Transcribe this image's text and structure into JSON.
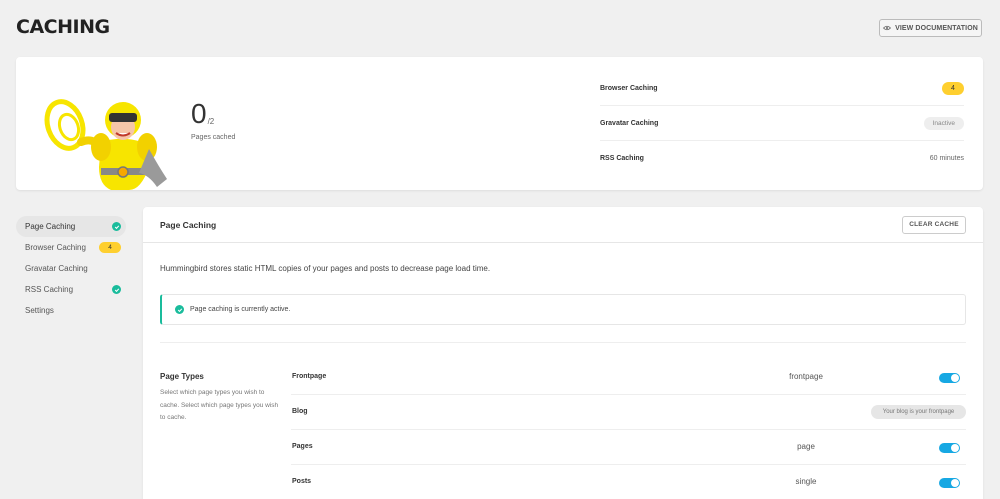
{
  "header": {
    "title": "CACHING",
    "doc_button": "VIEW DOCUMENTATION"
  },
  "summary": {
    "pages_cached": "0",
    "pages_total": "/2",
    "pages_cached_label": "Pages cached",
    "rows": [
      {
        "label": "Browser Caching",
        "value": "4"
      },
      {
        "label": "Gravatar Caching",
        "value": "Inactive"
      },
      {
        "label": "RSS Caching",
        "value": "60 minutes"
      }
    ]
  },
  "sidebar": {
    "items": [
      {
        "label": "Page Caching"
      },
      {
        "label": "Browser Caching",
        "badge": "4"
      },
      {
        "label": "Gravatar Caching"
      },
      {
        "label": "RSS Caching"
      },
      {
        "label": "Settings"
      }
    ]
  },
  "panel": {
    "title": "Page Caching",
    "clear_button": "CLEAR CACHE",
    "description": "Hummingbird stores static HTML copies of your pages and posts to decrease page load time.",
    "notice": "Page caching is currently active.",
    "page_types_title": "Page Types",
    "page_types_desc": "Select which page types you wish to cache. Select which page types you wish to cache.",
    "page_types": [
      {
        "name": "Frontpage",
        "value": "frontpage",
        "enabled": true
      },
      {
        "name": "Blog",
        "pill": "Your blog is your frontpage"
      },
      {
        "name": "Pages",
        "value": "page",
        "enabled": true
      },
      {
        "name": "Posts",
        "value": "single",
        "enabled": true
      }
    ]
  },
  "colors": {
    "accent_green": "#1abc9c",
    "accent_yellow": "#fecf2f",
    "toggle_blue": "#17a8e3"
  },
  "icons": [
    "eye-icon",
    "check-icon",
    "mascot-illustration"
  ]
}
